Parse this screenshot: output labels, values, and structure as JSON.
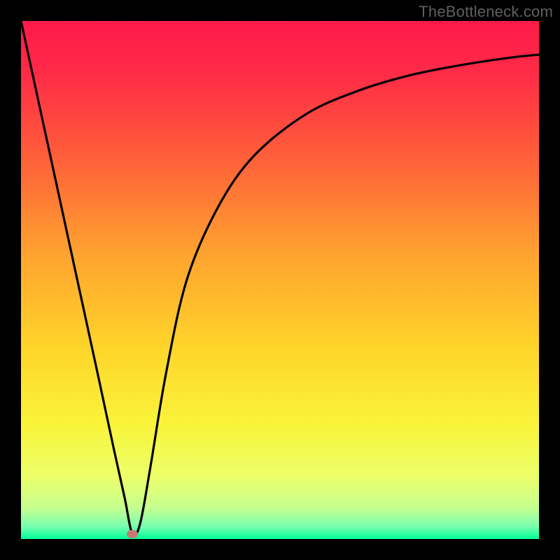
{
  "watermark": "TheBottleneck.com",
  "colors": {
    "frame": "#000000",
    "curve": "#000000",
    "marker": "#c77a72",
    "gradient_stops": [
      {
        "offset": 0,
        "color": "#ff1a4a"
      },
      {
        "offset": 0.1,
        "color": "#ff2b47"
      },
      {
        "offset": 0.25,
        "color": "#ff5a3a"
      },
      {
        "offset": 0.45,
        "color": "#ffa32f"
      },
      {
        "offset": 0.62,
        "color": "#ffd22a"
      },
      {
        "offset": 0.78,
        "color": "#f9f43a"
      },
      {
        "offset": 0.88,
        "color": "#ecff6a"
      },
      {
        "offset": 0.94,
        "color": "#c5ff8f"
      },
      {
        "offset": 0.975,
        "color": "#7bffae"
      },
      {
        "offset": 1.0,
        "color": "#00ff99"
      }
    ]
  },
  "chart_data": {
    "type": "line",
    "title": "",
    "xlabel": "",
    "ylabel": "",
    "xlim": [
      0,
      100
    ],
    "ylim": [
      0,
      100
    ],
    "grid": false,
    "series": [
      {
        "name": "bottleneck-curve",
        "x": [
          0,
          5,
          10,
          15,
          18,
          20,
          21.5,
          23,
          25,
          28,
          32,
          38,
          45,
          55,
          65,
          75,
          85,
          95,
          100
        ],
        "y": [
          100,
          77,
          54,
          31,
          17,
          8,
          1,
          3,
          14,
          32,
          50,
          64,
          74,
          82,
          86.5,
          89.5,
          91.5,
          93,
          93.5
        ]
      }
    ],
    "annotations": [
      {
        "name": "min-marker",
        "x": 21.5,
        "y": 1
      }
    ]
  }
}
